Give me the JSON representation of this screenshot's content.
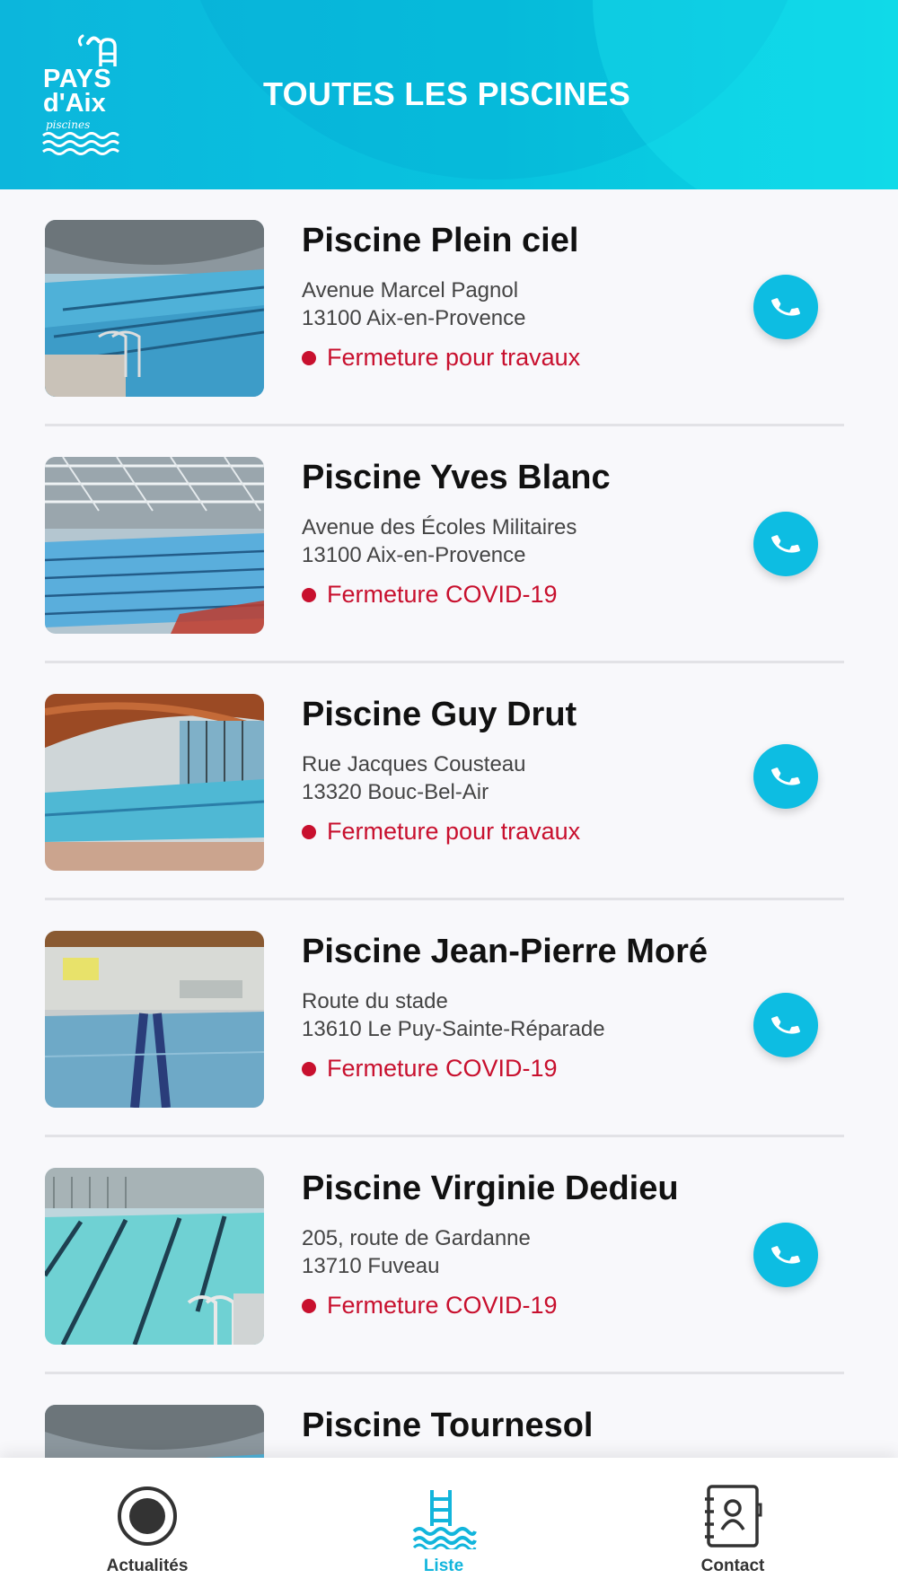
{
  "header": {
    "title": "TOUTES LES PISCINES",
    "logo": {
      "line1": "PAYS",
      "line2": "d'Aix",
      "line3": "piscines"
    }
  },
  "colors": {
    "accent": "#12b5dc",
    "status_red": "#c8102e"
  },
  "pools": [
    {
      "name": "Piscine Plein ciel",
      "address_line1": "Avenue Marcel Pagnol",
      "address_line2": "13100 Aix-en-Provence",
      "status": "Fermeture pour travaux"
    },
    {
      "name": "Piscine Yves Blanc",
      "address_line1": "Avenue des Écoles Militaires",
      "address_line2": "13100 Aix-en-Provence",
      "status": "Fermeture COVID-19"
    },
    {
      "name": "Piscine Guy Drut",
      "address_line1": "Rue Jacques Cousteau",
      "address_line2": "13320 Bouc-Bel-Air",
      "status": "Fermeture pour travaux"
    },
    {
      "name": "Piscine Jean-Pierre Moré",
      "address_line1": "Route du stade",
      "address_line2": "13610 Le Puy-Sainte-Réparade",
      "status": "Fermeture COVID-19"
    },
    {
      "name": "Piscine Virginie Dedieu",
      "address_line1": "205, route de Gardanne",
      "address_line2": "13710 Fuveau",
      "status": "Fermeture COVID-19"
    },
    {
      "name": "Piscine Tournesol"
    }
  ],
  "nav": {
    "items": [
      {
        "label": "Actualités",
        "icon": "record-icon"
      },
      {
        "label": "Liste",
        "icon": "pool-ladder-icon"
      },
      {
        "label": "Contact",
        "icon": "address-book-icon"
      }
    ]
  }
}
